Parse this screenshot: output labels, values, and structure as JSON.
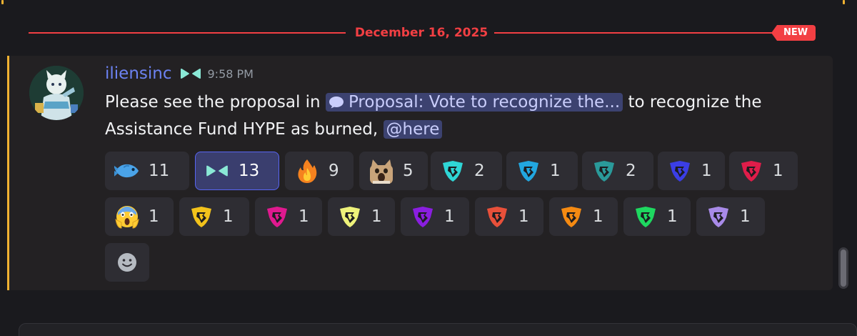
{
  "divider": {
    "date": "December 16, 2025",
    "new_label": "NEW"
  },
  "message": {
    "username": "iliensinc",
    "timestamp": "9:58 PM",
    "text_before": "Please see the proposal in ",
    "channel_mention": "Proposal: Vote to recognize the...",
    "text_middle": " to recognize the Assistance Fund HYPE as burned, ",
    "here_mention": "@here"
  },
  "reactions": [
    {
      "emoji": "fish",
      "count": "11",
      "active": false
    },
    {
      "emoji": "hyperliquid-logo",
      "count": "13",
      "active": true
    },
    {
      "emoji": "fire",
      "count": "9",
      "active": false
    },
    {
      "emoji": "pop-cat",
      "count": "5",
      "active": false
    },
    {
      "emoji": "shield-cyan",
      "count": "2",
      "active": false,
      "color": "#2fd6d6"
    },
    {
      "emoji": "shield-blue",
      "count": "1",
      "active": false,
      "color": "#22a7e0"
    },
    {
      "emoji": "shield-teal",
      "count": "2",
      "active": false,
      "color": "#2a9a9a"
    },
    {
      "emoji": "shield-indigo",
      "count": "1",
      "active": false,
      "color": "#3b3ee6"
    },
    {
      "emoji": "shield-crimson",
      "count": "1",
      "active": false,
      "color": "#e01d4a"
    },
    {
      "emoji": "screaming-face",
      "count": "1",
      "active": false
    },
    {
      "emoji": "shield-yellow",
      "count": "1",
      "active": false,
      "color": "#f2c21b"
    },
    {
      "emoji": "shield-magenta",
      "count": "1",
      "active": false,
      "color": "#e0198f"
    },
    {
      "emoji": "shield-lime",
      "count": "1",
      "active": false,
      "color": "#eef27a"
    },
    {
      "emoji": "shield-purple",
      "count": "1",
      "active": false,
      "color": "#8a1ee0"
    },
    {
      "emoji": "shield-red",
      "count": "1",
      "active": false,
      "color": "#e8503a"
    },
    {
      "emoji": "shield-orange",
      "count": "1",
      "active": false,
      "color": "#f58a12"
    },
    {
      "emoji": "shield-green",
      "count": "1",
      "active": false,
      "color": "#1ed860"
    },
    {
      "emoji": "shield-lavender",
      "count": "1",
      "active": false,
      "color": "#a88ae8"
    }
  ],
  "colors": {
    "accent_red": "#f23f43",
    "username": "#6c82f2",
    "mention_bg": "#3c4270",
    "active_reaction_border": "#5865f2",
    "unread_bar": "#f0b232"
  }
}
